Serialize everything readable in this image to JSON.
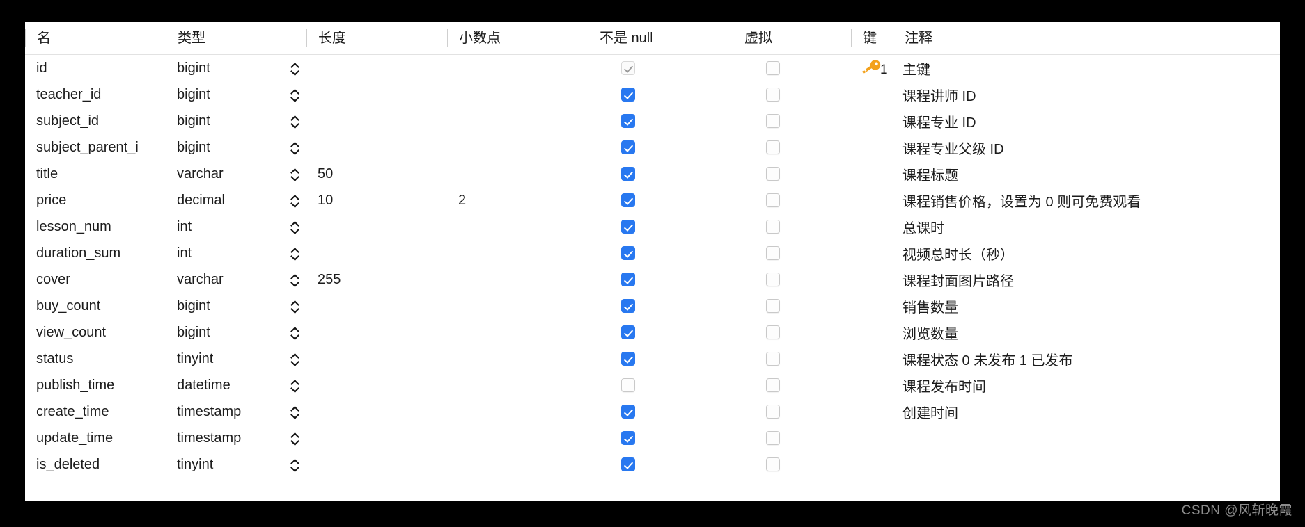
{
  "table": {
    "headers": {
      "name": "名",
      "type": "类型",
      "length": "长度",
      "decimal": "小数点",
      "not_null": "不是 null",
      "virtual": "虚拟",
      "key": "键",
      "comment": "注释"
    },
    "key_badge": "1",
    "rows": [
      {
        "name": "id",
        "type": "bigint",
        "length": "",
        "decimal": "",
        "not_null": "checked-disabled",
        "virtual": "unchecked",
        "key": "primary",
        "comment": "主键"
      },
      {
        "name": "teacher_id",
        "type": "bigint",
        "length": "",
        "decimal": "",
        "not_null": "checked",
        "virtual": "unchecked",
        "key": "",
        "comment": "课程讲师 ID"
      },
      {
        "name": "subject_id",
        "type": "bigint",
        "length": "",
        "decimal": "",
        "not_null": "checked",
        "virtual": "unchecked",
        "key": "",
        "comment": "课程专业 ID"
      },
      {
        "name": "subject_parent_i",
        "type": "bigint",
        "length": "",
        "decimal": "",
        "not_null": "checked",
        "virtual": "unchecked",
        "key": "",
        "comment": "课程专业父级 ID"
      },
      {
        "name": "title",
        "type": "varchar",
        "length": "50",
        "decimal": "",
        "not_null": "checked",
        "virtual": "unchecked",
        "key": "",
        "comment": "课程标题"
      },
      {
        "name": "price",
        "type": "decimal",
        "length": "10",
        "decimal": "2",
        "not_null": "checked",
        "virtual": "unchecked",
        "key": "",
        "comment": "课程销售价格，设置为 0 则可免费观看"
      },
      {
        "name": "lesson_num",
        "type": "int",
        "length": "",
        "decimal": "",
        "not_null": "checked",
        "virtual": "unchecked",
        "key": "",
        "comment": "总课时"
      },
      {
        "name": "duration_sum",
        "type": "int",
        "length": "",
        "decimal": "",
        "not_null": "checked",
        "virtual": "unchecked",
        "key": "",
        "comment": "视频总时长（秒）"
      },
      {
        "name": "cover",
        "type": "varchar",
        "length": "255",
        "decimal": "",
        "not_null": "checked",
        "virtual": "unchecked",
        "key": "",
        "comment": "课程封面图片路径"
      },
      {
        "name": "buy_count",
        "type": "bigint",
        "length": "",
        "decimal": "",
        "not_null": "checked",
        "virtual": "unchecked",
        "key": "",
        "comment": "销售数量"
      },
      {
        "name": "view_count",
        "type": "bigint",
        "length": "",
        "decimal": "",
        "not_null": "checked",
        "virtual": "unchecked",
        "key": "",
        "comment": "浏览数量"
      },
      {
        "name": "status",
        "type": "tinyint",
        "length": "",
        "decimal": "",
        "not_null": "checked",
        "virtual": "unchecked",
        "key": "",
        "comment": "课程状态 0 未发布 1 已发布"
      },
      {
        "name": "publish_time",
        "type": "datetime",
        "length": "",
        "decimal": "",
        "not_null": "unchecked",
        "virtual": "unchecked",
        "key": "",
        "comment": "课程发布时间"
      },
      {
        "name": "create_time",
        "type": "timestamp",
        "length": "",
        "decimal": "",
        "not_null": "checked",
        "virtual": "unchecked",
        "key": "",
        "comment": "创建时间"
      },
      {
        "name": "update_time",
        "type": "timestamp",
        "length": "",
        "decimal": "",
        "not_null": "checked",
        "virtual": "unchecked",
        "key": "",
        "comment": ""
      },
      {
        "name": "is_deleted",
        "type": "tinyint",
        "length": "",
        "decimal": "",
        "not_null": "checked",
        "virtual": "unchecked",
        "key": "",
        "comment": ""
      }
    ]
  },
  "watermark": "CSDN @风斩晚霞",
  "colors": {
    "checkbox_on": "#2878f0",
    "key_icon": "#f3a11b",
    "panel_bg": "#ffffff",
    "page_bg": "#000000"
  }
}
